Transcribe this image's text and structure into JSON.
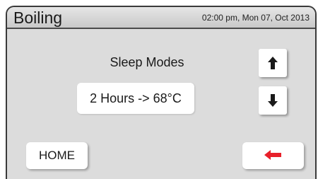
{
  "header": {
    "title": "Boiling",
    "datetime": "02:00 pm, Mon 07, Oct 2013"
  },
  "main": {
    "mode_label": "Sleep Modes",
    "value": "2 Hours -> 68°C"
  },
  "controls": {
    "up_icon": "arrow-up-icon",
    "down_icon": "arrow-down-icon",
    "home_label": "HOME",
    "back_icon": "arrow-left-icon"
  },
  "colors": {
    "background": "#dcdcdc",
    "back_arrow": "#e8202a",
    "arrows": "#1a1a1a"
  }
}
